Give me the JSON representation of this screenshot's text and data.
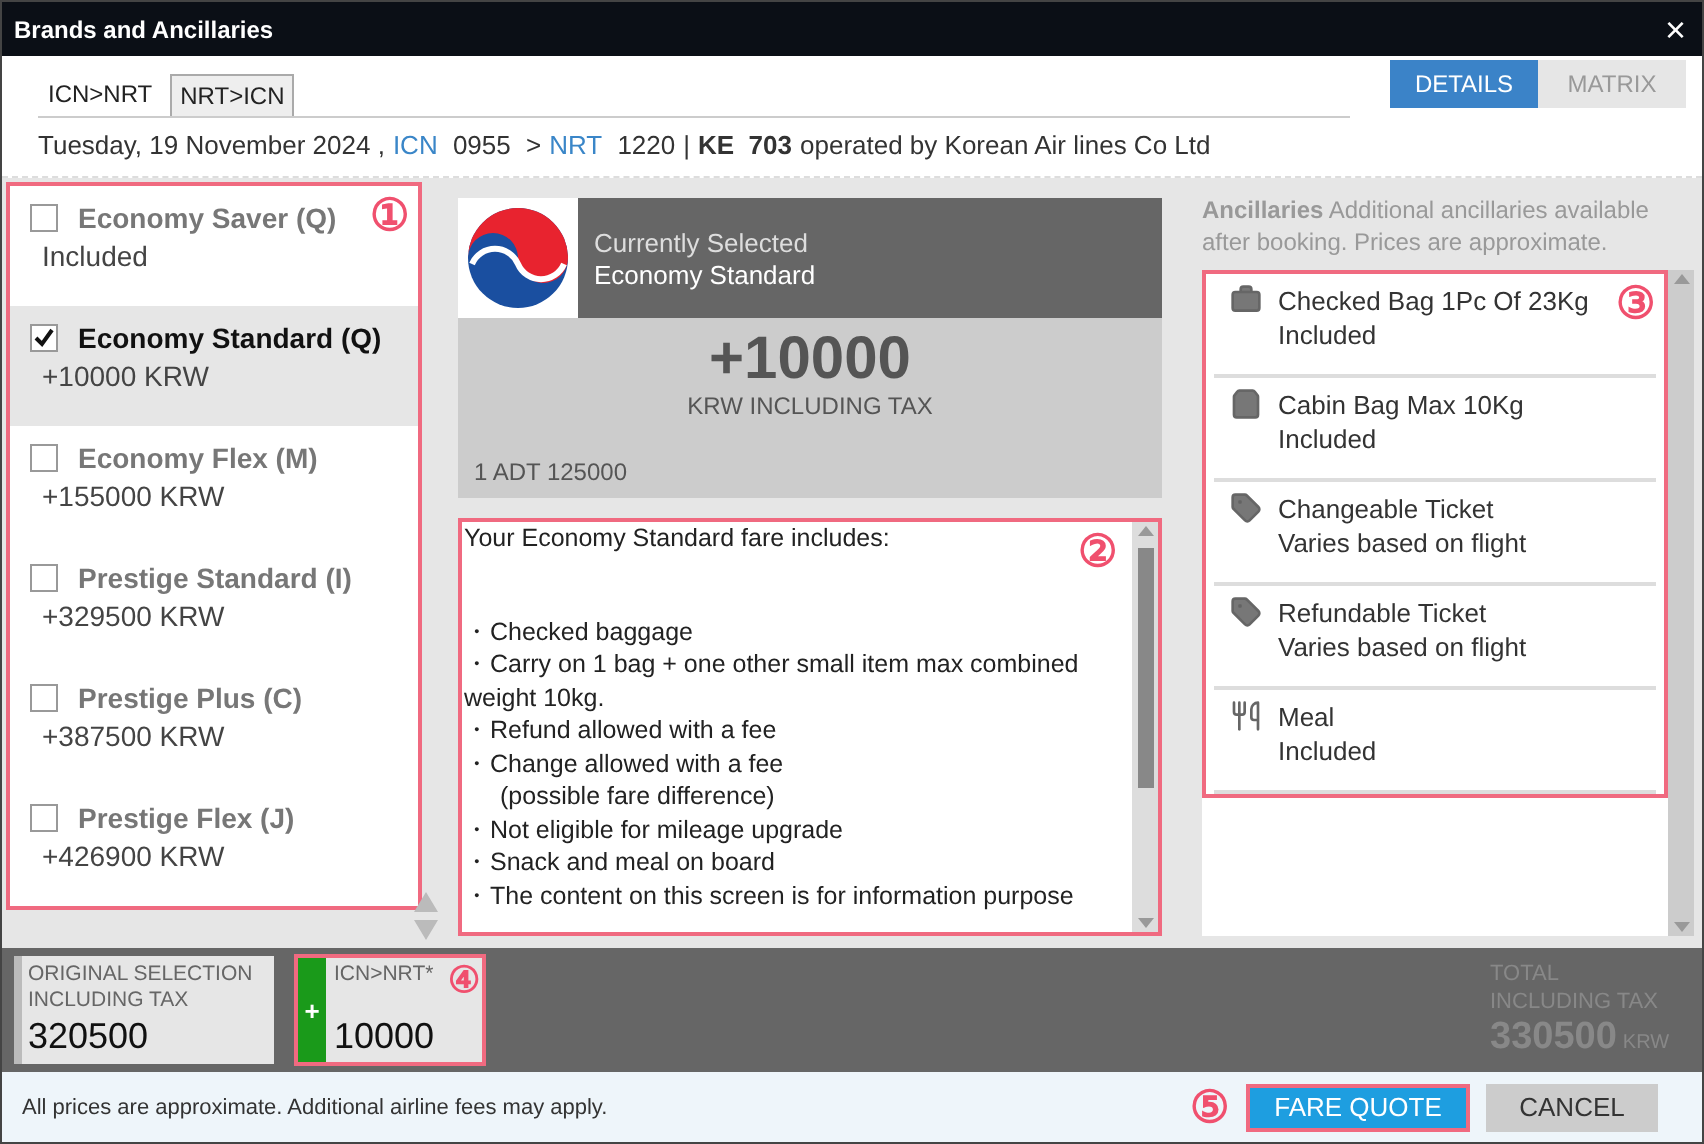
{
  "window": {
    "title": "Brands and Ancillaries",
    "close": "×"
  },
  "route_tabs": [
    {
      "label": "ICN>NRT",
      "selected": true
    },
    {
      "label": "NRT>ICN",
      "selected": false
    }
  ],
  "view_tabs": [
    {
      "label": "DETAILS",
      "selected": true
    },
    {
      "label": "MATRIX",
      "selected": false
    }
  ],
  "flight": {
    "date": "Tuesday, 19 November 2024 ,",
    "origin": "ICN",
    "departure": "0955",
    "arrow": ">",
    "destination": "NRT",
    "arrival": "1220",
    "separator": "|",
    "flight_number": "KE  703",
    "operator": "operated by Korean Air lines Co Ltd"
  },
  "fares": {
    "callout": "①",
    "items": [
      {
        "name": "Economy Saver (Q)",
        "price": "Included",
        "selected": false
      },
      {
        "name": "Economy Standard (Q)",
        "price": "+10000  KRW",
        "selected": true
      },
      {
        "name": "Economy Flex (M)",
        "price": "+155000  KRW",
        "selected": false
      },
      {
        "name": "Prestige Standard (I)",
        "price": "+329500  KRW",
        "selected": false
      },
      {
        "name": "Prestige Plus (C)",
        "price": "+387500  KRW",
        "selected": false
      },
      {
        "name": "Prestige Flex (J)",
        "price": "+426900  KRW",
        "selected": false
      }
    ]
  },
  "current": {
    "heading": "Currently Selected",
    "brand": "Economy Standard",
    "amount": "+10000",
    "amount_note": "KRW INCLUDING TAX",
    "passengers": "1 ADT 125000"
  },
  "fare_details": {
    "callout": "②",
    "intro": "Your Economy Standard fare includes:",
    "lines": [
      {
        "kind": "bullet",
        "text": "・Checked baggage"
      },
      {
        "kind": "bullet",
        "text": "・Carry on 1 bag + one other small item max combined weight 10kg."
      },
      {
        "kind": "bullet",
        "text": "・Refund allowed with a fee"
      },
      {
        "kind": "bullet",
        "text": "・Change allowed with a fee"
      },
      {
        "kind": "continuation",
        "text": "(possible fare difference)"
      },
      {
        "kind": "bullet",
        "text": "・Not eligible for mileage upgrade"
      },
      {
        "kind": "bullet",
        "text": "・Snack and meal on board"
      },
      {
        "kind": "bullet",
        "text": "・The content on this screen is for information purpose"
      }
    ]
  },
  "ancillaries": {
    "title": "Ancillaries",
    "note": "Additional ancillaries available after booking. Prices are approximate.",
    "callout": "③",
    "items": [
      {
        "kind": "checked-bag",
        "name": "Checked Bag 1Pc Of 23Kg",
        "status": "Included"
      },
      {
        "kind": "cabin-bag",
        "name": "Cabin Bag Max 10Kg",
        "status": "Included"
      },
      {
        "kind": "ticket",
        "name": "Changeable Ticket",
        "status": "Varies based on flight"
      },
      {
        "kind": "ticket",
        "name": "Refundable Ticket",
        "status": "Varies based on flight"
      },
      {
        "kind": "meal",
        "name": "Meal",
        "status": "Included"
      }
    ]
  },
  "summary": {
    "original": {
      "label": "ORIGINAL SELECTION INCLUDING TAX",
      "amount": "320500"
    },
    "change": {
      "sign": "+",
      "label": "ICN>NRT*",
      "amount": "10000",
      "callout": "④"
    },
    "total": {
      "label": "TOTAL INCLUDING TAX",
      "amount": "330500",
      "currency": "KRW"
    }
  },
  "footer": {
    "note": "All prices are approximate. Additional airline fees may apply.",
    "callout": "⑤",
    "buttons": [
      {
        "kind": "primary",
        "label": "FARE QUOTE"
      },
      {
        "kind": "secondary",
        "label": "CANCEL"
      }
    ]
  }
}
